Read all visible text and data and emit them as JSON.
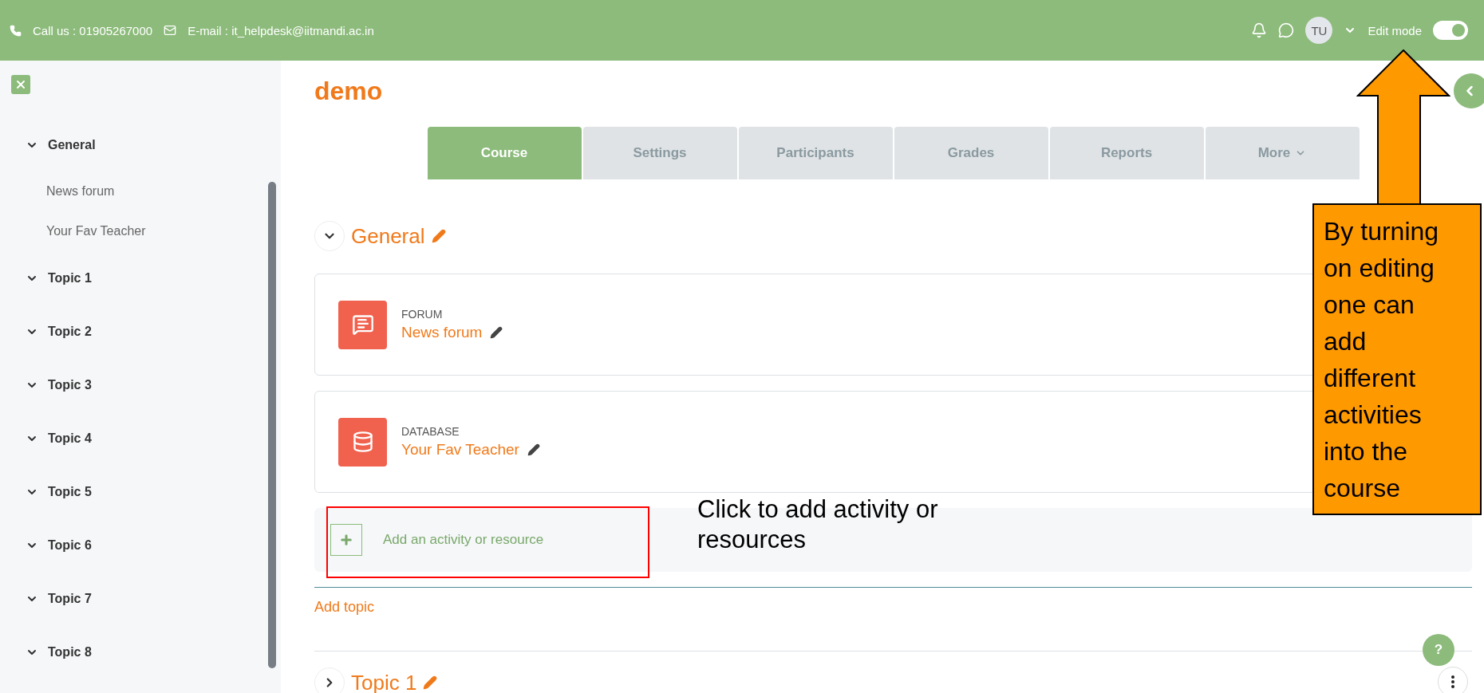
{
  "topbar": {
    "phone": "Call us : 01905267000",
    "email": "E-mail : it_helpdesk@iitmandi.ac.in",
    "user_initials": "TU",
    "edit_mode": {
      "label": "Edit mode",
      "on": true
    }
  },
  "sidebar": {
    "items": [
      {
        "label": "General",
        "expanded": true,
        "children": [
          {
            "label": "News forum"
          },
          {
            "label": "Your Fav Teacher"
          }
        ]
      },
      {
        "label": "Topic 1",
        "expanded": true
      },
      {
        "label": "Topic 2",
        "expanded": true
      },
      {
        "label": "Topic 3",
        "expanded": true
      },
      {
        "label": "Topic 4",
        "expanded": true
      },
      {
        "label": "Topic 5",
        "expanded": true
      },
      {
        "label": "Topic 6",
        "expanded": true
      },
      {
        "label": "Topic 7",
        "expanded": true
      },
      {
        "label": "Topic 8",
        "expanded": true
      }
    ]
  },
  "course_title": "demo",
  "tabs": [
    {
      "label": "Course",
      "selected": true
    },
    {
      "label": "Settings",
      "selected": false
    },
    {
      "label": "Participants",
      "selected": false
    },
    {
      "label": "Grades",
      "selected": false
    },
    {
      "label": "Reports",
      "selected": false
    },
    {
      "label": "More",
      "selected": false
    }
  ],
  "sections": [
    {
      "title": "General",
      "expanded": true,
      "activities": [
        {
          "kind": "forum",
          "type_label": "FORUM",
          "name": "News forum"
        },
        {
          "kind": "database",
          "type_label": "DATABASE",
          "name": "Your Fav Teacher"
        }
      ],
      "add_activity": "Add an activity or resource",
      "add_topic": "Add topic"
    },
    {
      "title": "Topic 1",
      "expanded": false
    }
  ],
  "help_label": "?",
  "annotations": {
    "callout": "Click to add activity or resources",
    "note": "By turning on editing one can add different activities into the course"
  }
}
